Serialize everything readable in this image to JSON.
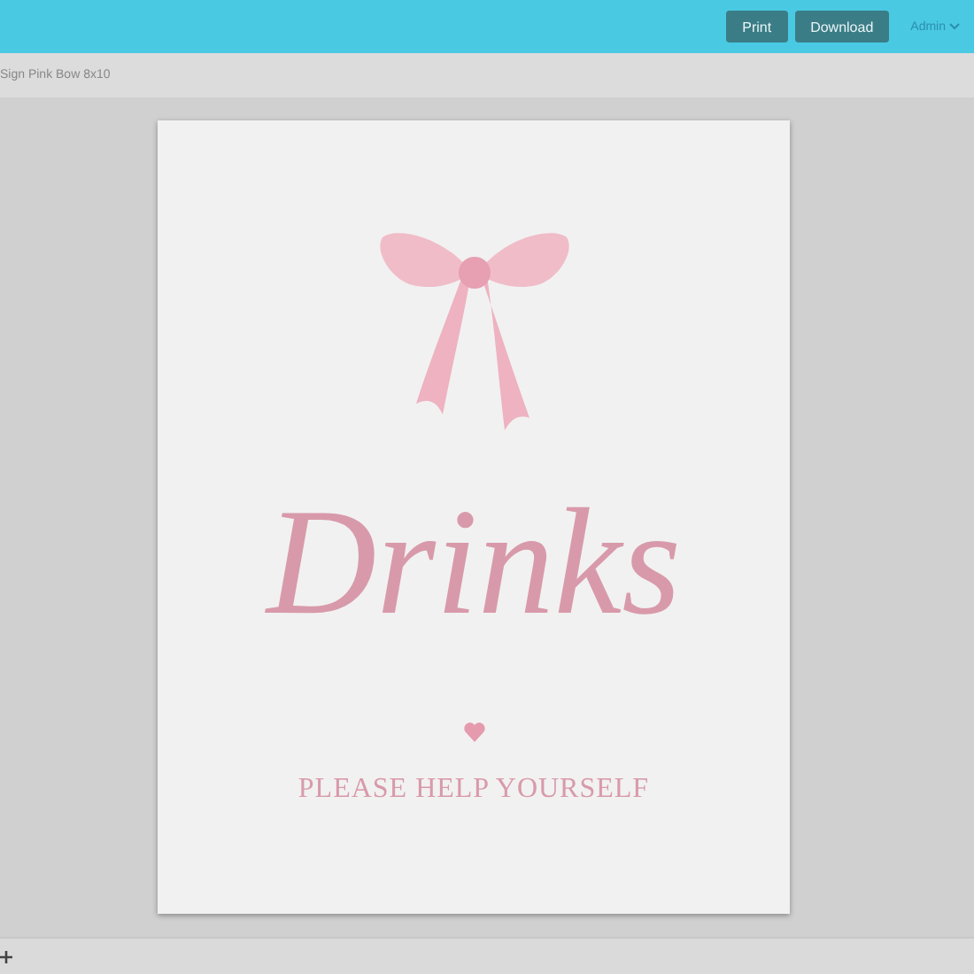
{
  "toolbar": {
    "buttons": [
      "Print",
      "Download"
    ],
    "user_menu": "Admin"
  },
  "document": {
    "title": "Sign Pink Bow 8x10"
  },
  "page": {
    "heading": "Drinks",
    "subheading": "PLEASE HELP YOURSELF"
  }
}
